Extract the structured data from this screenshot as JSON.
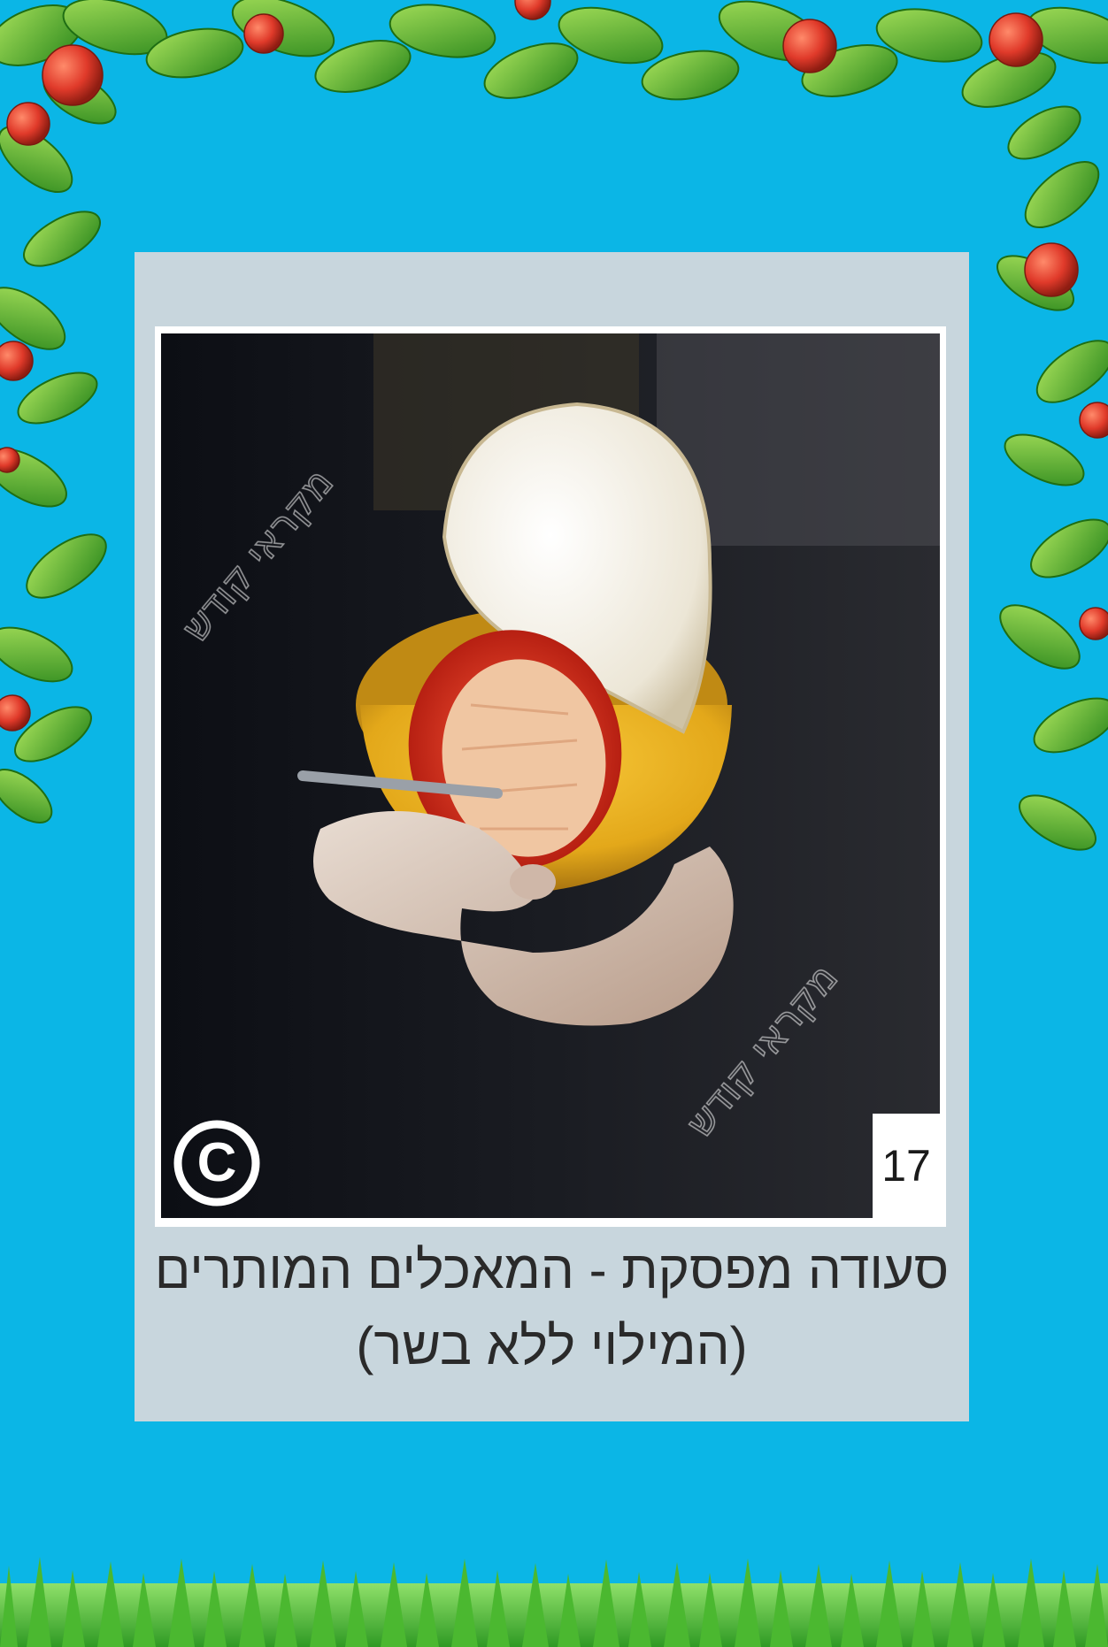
{
  "card": {
    "number": "17",
    "title_line1": "סעודה מפסקת - המאכלים המותרים",
    "title_line2": "(המילוי ללא בשר)",
    "watermark": "מקראי קודש",
    "copyright_symbol": "©"
  },
  "decor": {
    "background_color": "#0bb6e6",
    "leaf_color": "#4caf2a",
    "fruit_color": "#e03a2a",
    "grass_color": "#5cc43a"
  },
  "icons": [
    "copyright-icon"
  ]
}
